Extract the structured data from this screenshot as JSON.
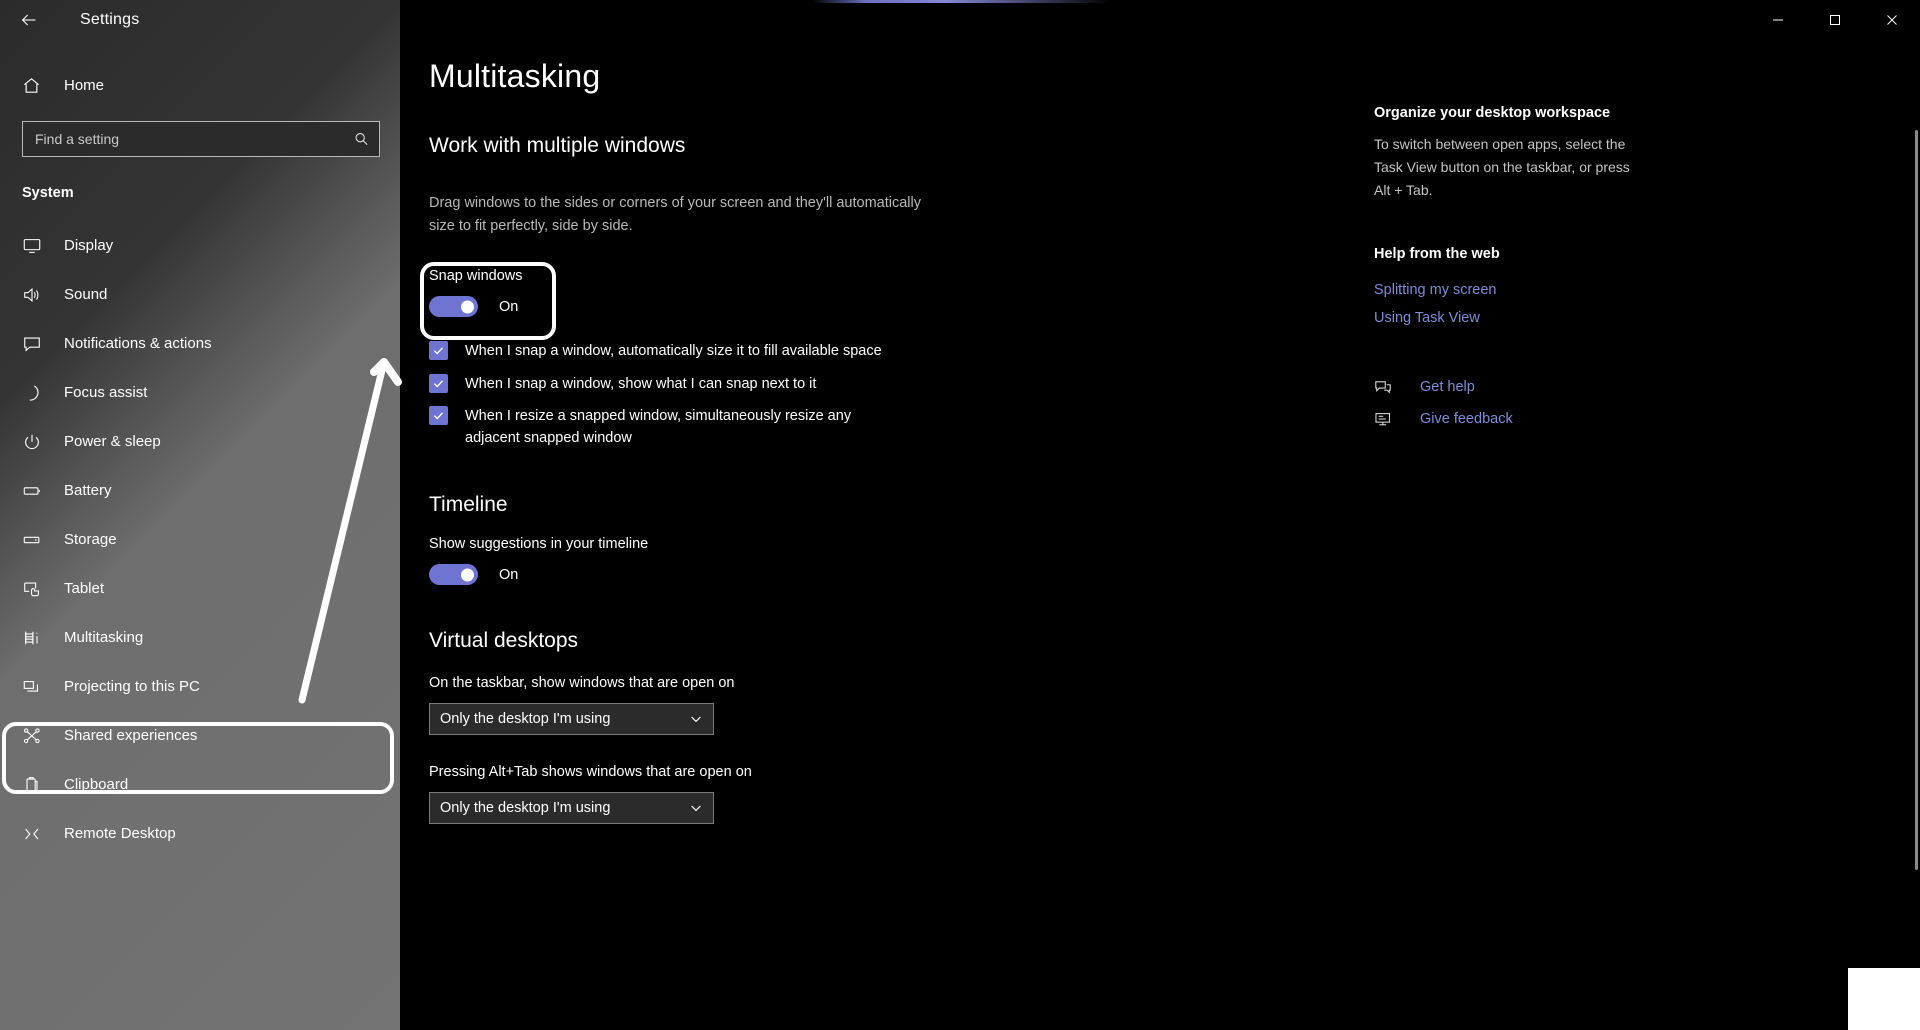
{
  "window": {
    "title": "Settings",
    "back_icon": "back-arrow-icon",
    "minimize_label": "—",
    "maximize_label": "❐",
    "close_label": "✕"
  },
  "sidebar": {
    "home_label": "Home",
    "home_icon": "home-icon",
    "search": {
      "placeholder": "Find a setting",
      "value": "",
      "icon": "search-icon"
    },
    "section_title": "System",
    "items": [
      {
        "label": "Display",
        "icon": "monitor-icon",
        "selected": false
      },
      {
        "label": "Sound",
        "icon": "speaker-icon",
        "selected": false
      },
      {
        "label": "Notifications & actions",
        "icon": "chat-bubble-icon",
        "selected": false
      },
      {
        "label": "Focus assist",
        "icon": "moon-icon",
        "selected": false
      },
      {
        "label": "Power & sleep",
        "icon": "power-icon",
        "selected": false
      },
      {
        "label": "Battery",
        "icon": "battery-icon",
        "selected": false
      },
      {
        "label": "Storage",
        "icon": "drive-icon",
        "selected": false
      },
      {
        "label": "Tablet",
        "icon": "tablet-touch-icon",
        "selected": false
      },
      {
        "label": "Multitasking",
        "icon": "multitasking-icon",
        "selected": true
      },
      {
        "label": "Projecting to this PC",
        "icon": "project-screen-icon",
        "selected": false
      },
      {
        "label": "Shared experiences",
        "icon": "share-nodes-icon",
        "selected": false
      },
      {
        "label": "Clipboard",
        "icon": "clipboard-icon",
        "selected": false
      },
      {
        "label": "Remote Desktop",
        "icon": "remote-desktop-icon",
        "selected": false
      }
    ]
  },
  "main": {
    "page_title": "Multitasking",
    "work_heading": "Work with multiple windows",
    "work_description": "Drag windows to the sides or corners of your screen and they'll automatically size to fit perfectly, side by side.",
    "snap": {
      "label": "Snap windows",
      "state": "On",
      "checked": true
    },
    "snap_options": [
      {
        "label": "When I snap a window, automatically size it to fill available space",
        "checked": true
      },
      {
        "label": "When I snap a window, show what I can snap next to it",
        "checked": true
      },
      {
        "label": "When I resize a snapped window, simultaneously resize any adjacent snapped window",
        "checked": true
      }
    ],
    "timeline": {
      "heading": "Timeline",
      "label": "Show suggestions in your timeline",
      "state": "On",
      "checked": true
    },
    "virtual_desktops": {
      "heading": "Virtual desktops",
      "taskbar_label": "On the taskbar, show windows that are open on",
      "taskbar_value": "Only the desktop I'm using",
      "alttab_label": "Pressing Alt+Tab shows windows that are open on",
      "alttab_value": "Only the desktop I'm using",
      "chevron_icon": "chevron-down-icon"
    }
  },
  "rail": {
    "organize_heading": "Organize your desktop workspace",
    "organize_body": "To switch between open apps, select the Task View button on the taskbar, or press Alt + Tab.",
    "help_heading": "Help from the web",
    "links": [
      "Splitting my screen",
      "Using Task View"
    ],
    "actions": [
      {
        "label": "Get help",
        "icon": "get-help-icon"
      },
      {
        "label": "Give feedback",
        "icon": "give-feedback-icon"
      }
    ]
  },
  "colors": {
    "accent": "#6f74d2",
    "link": "#7f8cd6",
    "content_bg": "#000000",
    "annotation": "#ffffff"
  },
  "annotations": [
    {
      "name": "snap-windows-highlight",
      "shape": "rounded-rect"
    },
    {
      "name": "multitasking-nav-highlight",
      "shape": "rounded-rect"
    },
    {
      "name": "pointer-arrow",
      "shape": "arrow"
    }
  ]
}
